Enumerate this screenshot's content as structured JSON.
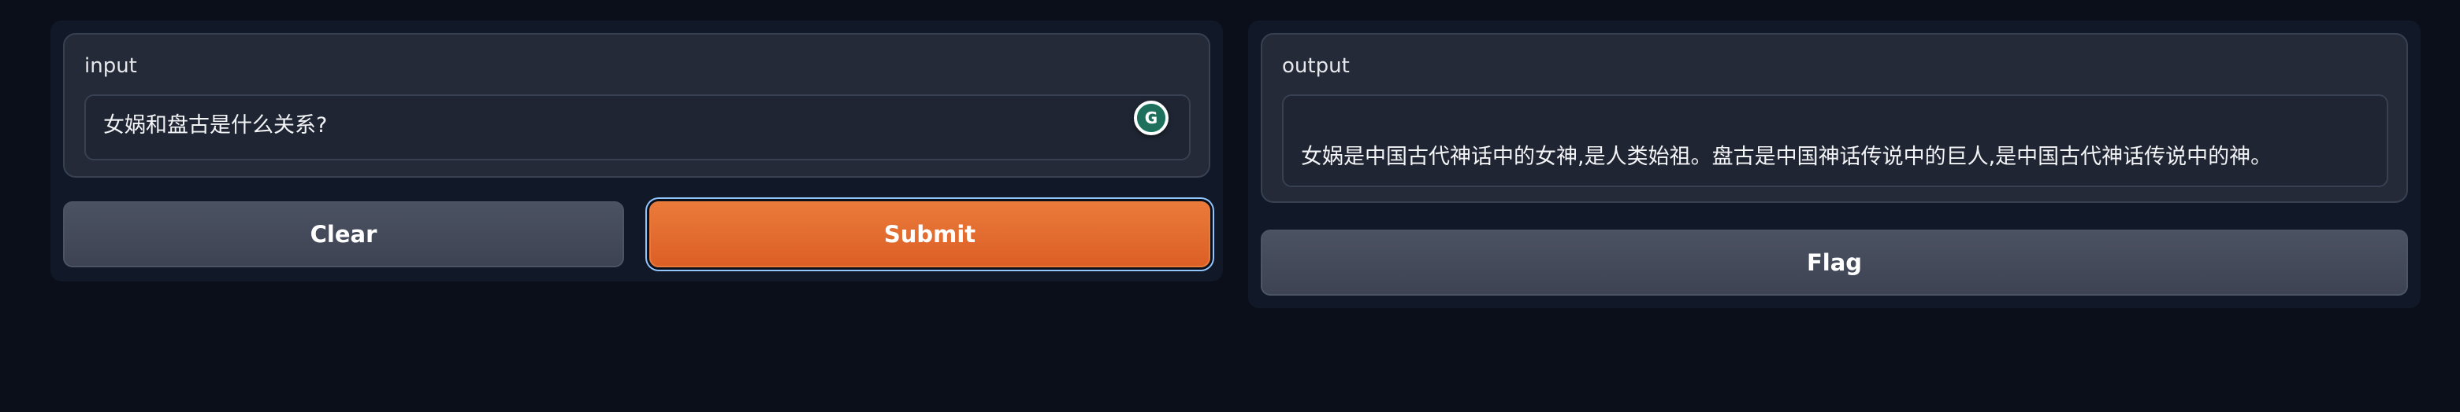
{
  "input_panel": {
    "label": "input",
    "value": "女娲和盘古是什么关系?",
    "grammarly_icon_letter": "G"
  },
  "output_panel": {
    "label": "output",
    "value": "女娲是中国古代神话中的女神,是人类始祖。盘古是中国神话传说中的巨人,是中国古代神话传说中的神。"
  },
  "buttons": {
    "clear": "Clear",
    "submit": "Submit",
    "flag": "Flag"
  },
  "colors": {
    "background": "#0b0f19",
    "panel": "#111827",
    "block": "#242a38",
    "primary_button": "#e5682e",
    "secondary_button": "#464c5b"
  },
  "icons": {
    "grammarly": "grammarly-icon"
  }
}
